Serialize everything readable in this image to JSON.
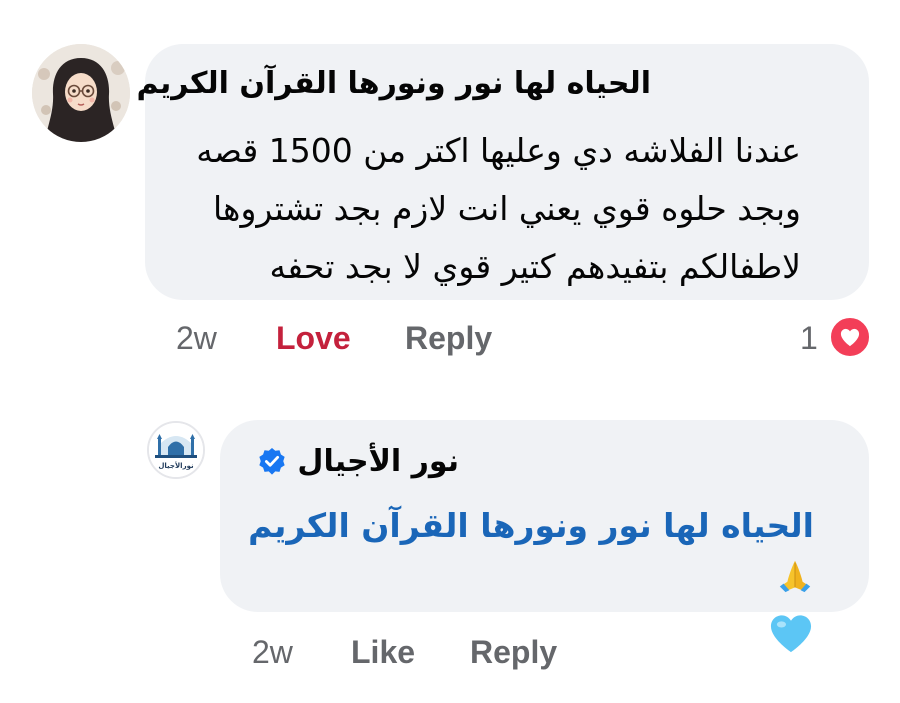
{
  "main_comment": {
    "author": "الحياه لها نور ونورها القرآن الكريم",
    "text": "عندنا الفلاشه دي وعليها اكتر من 1500 قصه وبجد حلوه قوي يعني انت لازم بجد تشتروها لاطفالكم بتفيدهم كتير قوي لا بجد تحفه",
    "time": "2w",
    "reaction_label": "Love",
    "reply_label": "Reply",
    "reaction_count": "1",
    "reaction_icon": "heart-icon",
    "reaction_color": "#f33e58",
    "reaction_label_color": "#c4213c"
  },
  "reply_comment": {
    "author": "نور الأجيال",
    "verified_icon": "verified-badge-icon",
    "verified_color": "#1877f2",
    "text": "الحياه لها نور ونورها القرآن الكريم",
    "emojis": [
      "folded-hands-emoji",
      "blue-heart-emoji"
    ],
    "avatar_text": "نورالأجيال",
    "time": "2w",
    "like_label": "Like",
    "reply_label": "Reply",
    "text_color": "#1a66b8"
  }
}
